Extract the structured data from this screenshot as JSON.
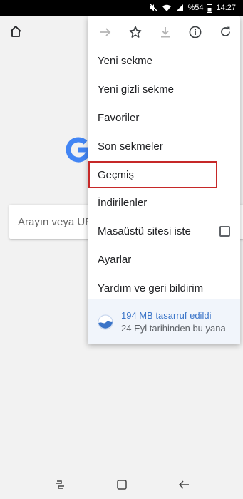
{
  "status_bar": {
    "battery_percent": "%54",
    "time": "14:27"
  },
  "search": {
    "placeholder": "Arayın veya URL"
  },
  "menu": {
    "icons": [
      "forward-icon",
      "star-icon",
      "download-icon",
      "info-icon",
      "refresh-icon"
    ],
    "items": [
      {
        "label": "Yeni sekme"
      },
      {
        "label": "Yeni gizli sekme"
      },
      {
        "label": "Favoriler"
      },
      {
        "label": "Son sekmeler"
      },
      {
        "label": "Geçmiş"
      },
      {
        "label": "İndirilenler"
      },
      {
        "label": "Masaüstü sitesi iste"
      },
      {
        "label": "Ayarlar"
      },
      {
        "label": "Yardım ve geri bildirim"
      }
    ],
    "savings": {
      "title": "194 MB tasarruf edildi",
      "subtitle": "24 Eyl tarihinden bu yana"
    }
  },
  "colors": {
    "highlight_border": "#c62828",
    "savings_accent": "#3a74c8",
    "google_blue": "#4285f4"
  }
}
